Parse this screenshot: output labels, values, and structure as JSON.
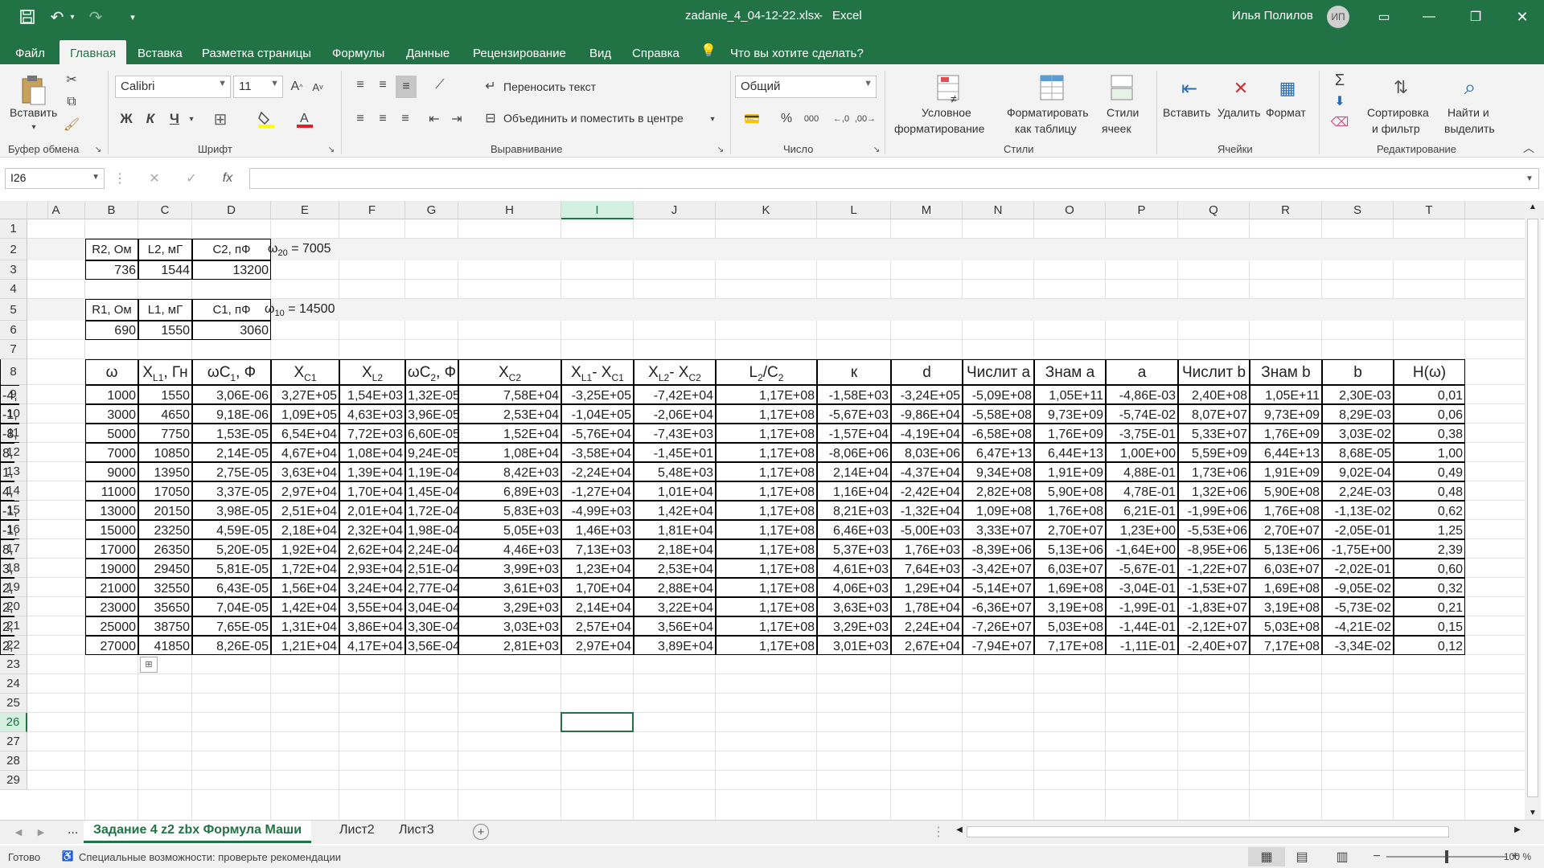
{
  "title": {
    "file": "zadanie_4_04-12-22.xlsx",
    "sep": "-",
    "app": "Excel",
    "user": "Илья Полилов",
    "initials": "ИП"
  },
  "tabs": [
    "Файл",
    "Главная",
    "Вставка",
    "Разметка страницы",
    "Формулы",
    "Данные",
    "Рецензирование",
    "Вид",
    "Справка"
  ],
  "tell_me": "Что вы хотите сделать?",
  "ribbon": {
    "paste": "Вставить",
    "clipboard": "Буфер обмена",
    "font_name": "Calibri",
    "font_size": "11",
    "font_group": "Шрифт",
    "bold": "Ж",
    "italic": "К",
    "underline": "Ч",
    "wrap": "Переносить текст",
    "merge": "Объединить и поместить в центре",
    "align_group": "Выравнивание",
    "num_format": "Общий",
    "num_group": "Число",
    "cond1": "Условное",
    "cond2": "форматирование",
    "fmt_table1": "Форматировать",
    "fmt_table2": "как таблицу",
    "styles1": "Стили",
    "styles2": "ячеек",
    "styles_group": "Стили",
    "insert": "Вставить",
    "delete": "Удалить",
    "format": "Формат",
    "cells_group": "Ячейки",
    "sort1": "Сортировка",
    "sort2": "и фильтр",
    "find1": "Найти и",
    "find2": "выделить",
    "edit_group": "Редактирование"
  },
  "namebox": "I26",
  "columns": [
    "A",
    "B",
    "C",
    "D",
    "E",
    "F",
    "G",
    "H",
    "I",
    "J",
    "K",
    "L",
    "M",
    "N",
    "O",
    "P",
    "Q",
    "R",
    "S",
    "T"
  ],
  "rows": [
    "1",
    "2",
    "3",
    "4",
    "5",
    "6",
    "7",
    "8",
    "9",
    "10",
    "11",
    "12",
    "13",
    "14",
    "15",
    "16",
    "17",
    "18",
    "19",
    "20",
    "21",
    "22",
    "23",
    "24",
    "25",
    "26",
    "27",
    "28",
    "29"
  ],
  "params": {
    "h2": [
      "R2,  Ом",
      "L2, мГ",
      "С2, пФ"
    ],
    "v2": [
      "736",
      "1544",
      "13200"
    ],
    "h1": [
      "R1,  Ом",
      "L1, мГ",
      "С1, пФ"
    ],
    "v1": [
      "690",
      "1550",
      "3060"
    ],
    "w20": "ω20 = 7005",
    "w10": "ω10 = 14500"
  },
  "headers": [
    "ω",
    "XL1, Гн",
    "ωC1, Ф",
    "XC1",
    "XL2",
    "ωC2, Ф",
    "XC2",
    "XL1- XC1",
    "XL2- XC2",
    "L2/C2",
    "к",
    "d",
    "Числит a",
    "Знам a",
    "a",
    "Числит b",
    "Знам b",
    "b",
    "H(ω)",
    ""
  ],
  "table": [
    [
      "1000",
      "1550",
      "3,06E-06",
      "3,27E+05",
      "1,54E+03",
      "1,32E-05",
      "7,58E+04",
      "-3,25E+05",
      "-7,42E+04",
      "1,17E+08",
      "-1,58E+03",
      "-3,24E+05",
      "-5,09E+08",
      "1,05E+11",
      "-4,86E-03",
      "2,40E+08",
      "1,05E+11",
      "2,30E-03",
      "0,01",
      "-4,"
    ],
    [
      "3000",
      "4650",
      "9,18E-06",
      "1,09E+05",
      "4,63E+03",
      "3,96E-05",
      "2,53E+04",
      "-1,04E+05",
      "-2,06E+04",
      "1,17E+08",
      "-5,67E+03",
      "-9,86E+04",
      "-5,58E+08",
      "9,73E+09",
      "-5,74E-02",
      "8,07E+07",
      "9,73E+09",
      "8,29E-03",
      "0,06",
      "-1,"
    ],
    [
      "5000",
      "7750",
      "1,53E-05",
      "6,54E+04",
      "7,72E+03",
      "6,60E-05",
      "1,52E+04",
      "-5,76E+04",
      "-7,43E+03",
      "1,17E+08",
      "-1,57E+04",
      "-4,19E+04",
      "-6,58E+08",
      "1,76E+09",
      "-3,75E-01",
      "5,33E+07",
      "1,76E+09",
      "3,03E-02",
      "0,38",
      "-8,"
    ],
    [
      "7000",
      "10850",
      "2,14E-05",
      "4,67E+04",
      "1,08E+04",
      "9,24E-05",
      "1,08E+04",
      "-3,58E+04",
      "-1,45E+01",
      "1,17E+08",
      "-8,06E+06",
      "8,03E+06",
      "6,47E+13",
      "6,44E+13",
      "1,00E+00",
      "5,59E+09",
      "6,44E+13",
      "8,68E-05",
      "1,00",
      "8,"
    ],
    [
      "9000",
      "13950",
      "2,75E-05",
      "3,63E+04",
      "1,39E+04",
      "1,19E-04",
      "8,42E+03",
      "-2,24E+04",
      "5,48E+03",
      "1,17E+08",
      "2,14E+04",
      "-4,37E+04",
      "9,34E+08",
      "1,91E+09",
      "4,88E-01",
      "1,73E+06",
      "1,91E+09",
      "9,02E-04",
      "0,49",
      "1,"
    ],
    [
      "11000",
      "17050",
      "3,37E-05",
      "2,97E+04",
      "1,70E+04",
      "1,45E-04",
      "6,89E+03",
      "-1,27E+04",
      "1,01E+04",
      "1,17E+08",
      "1,16E+04",
      "-2,42E+04",
      "2,82E+08",
      "5,90E+08",
      "4,78E-01",
      "1,32E+06",
      "5,90E+08",
      "2,24E-03",
      "0,48",
      "4,"
    ],
    [
      "13000",
      "20150",
      "3,98E-05",
      "2,51E+04",
      "2,01E+04",
      "1,72E-04",
      "5,83E+03",
      "-4,99E+03",
      "1,42E+04",
      "1,17E+08",
      "8,21E+03",
      "-1,32E+04",
      "1,09E+08",
      "1,76E+08",
      "6,21E-01",
      "-1,99E+06",
      "1,76E+08",
      "-1,13E-02",
      "0,62",
      "-1,"
    ],
    [
      "15000",
      "23250",
      "4,59E-05",
      "2,18E+04",
      "2,32E+04",
      "1,98E-04",
      "5,05E+03",
      "1,46E+03",
      "1,81E+04",
      "1,17E+08",
      "6,46E+03",
      "-5,00E+03",
      "3,33E+07",
      "2,70E+07",
      "1,23E+00",
      "-5,53E+06",
      "2,70E+07",
      "-2,05E-01",
      "1,25",
      "-1,"
    ],
    [
      "17000",
      "26350",
      "5,20E-05",
      "1,92E+04",
      "2,62E+04",
      "2,24E-04",
      "4,46E+03",
      "7,13E+03",
      "2,18E+04",
      "1,17E+08",
      "5,37E+03",
      "1,76E+03",
      "-8,39E+06",
      "5,13E+06",
      "-1,64E+00",
      "-8,95E+06",
      "5,13E+06",
      "-1,75E+00",
      "2,39",
      "8,"
    ],
    [
      "19000",
      "29450",
      "5,81E-05",
      "1,72E+04",
      "2,93E+04",
      "2,51E-04",
      "3,99E+03",
      "1,23E+04",
      "2,53E+04",
      "1,17E+08",
      "4,61E+03",
      "7,64E+03",
      "-3,42E+07",
      "6,03E+07",
      "-5,67E-01",
      "-1,22E+07",
      "6,03E+07",
      "-2,02E-01",
      "0,60",
      "3,"
    ],
    [
      "21000",
      "32550",
      "6,43E-05",
      "1,56E+04",
      "3,24E+04",
      "2,77E-04",
      "3,61E+03",
      "1,70E+04",
      "2,88E+04",
      "1,17E+08",
      "4,06E+03",
      "1,29E+04",
      "-5,14E+07",
      "1,69E+08",
      "-3,04E-01",
      "-1,53E+07",
      "1,69E+08",
      "-9,05E-02",
      "0,32",
      "2,"
    ],
    [
      "23000",
      "35650",
      "7,04E-05",
      "1,42E+04",
      "3,55E+04",
      "3,04E-04",
      "3,29E+03",
      "2,14E+04",
      "3,22E+04",
      "1,17E+08",
      "3,63E+03",
      "1,78E+04",
      "-6,36E+07",
      "3,19E+08",
      "-1,99E-01",
      "-1,83E+07",
      "3,19E+08",
      "-5,73E-02",
      "0,21",
      "2,"
    ],
    [
      "25000",
      "38750",
      "7,65E-05",
      "1,31E+04",
      "3,86E+04",
      "3,30E-04",
      "3,03E+03",
      "2,57E+04",
      "3,56E+04",
      "1,17E+08",
      "3,29E+03",
      "2,24E+04",
      "-7,26E+07",
      "5,03E+08",
      "-1,44E-01",
      "-2,12E+07",
      "5,03E+08",
      "-4,21E-02",
      "0,15",
      "2,"
    ],
    [
      "27000",
      "41850",
      "8,26E-05",
      "1,21E+04",
      "4,17E+04",
      "3,56E-04",
      "2,81E+03",
      "2,97E+04",
      "3,89E+04",
      "1,17E+08",
      "3,01E+03",
      "2,67E+04",
      "-7,94E+07",
      "7,17E+08",
      "-1,11E-01",
      "-2,40E+07",
      "7,17E+08",
      "-3,34E-02",
      "0,12",
      "2,"
    ]
  ],
  "sheet_tabs": {
    "more": "...",
    "active": "Задание 4 z2 zbx  Формула Маши",
    "t2": "Лист2",
    "t3": "Лист3"
  },
  "status": {
    "ready": "Готово",
    "access": "Специальные возможности: проверьте рекомендации",
    "zoom": "100 %"
  },
  "colors": {
    "accent": "#217346",
    "selected_col": "#d3f0e0"
  }
}
